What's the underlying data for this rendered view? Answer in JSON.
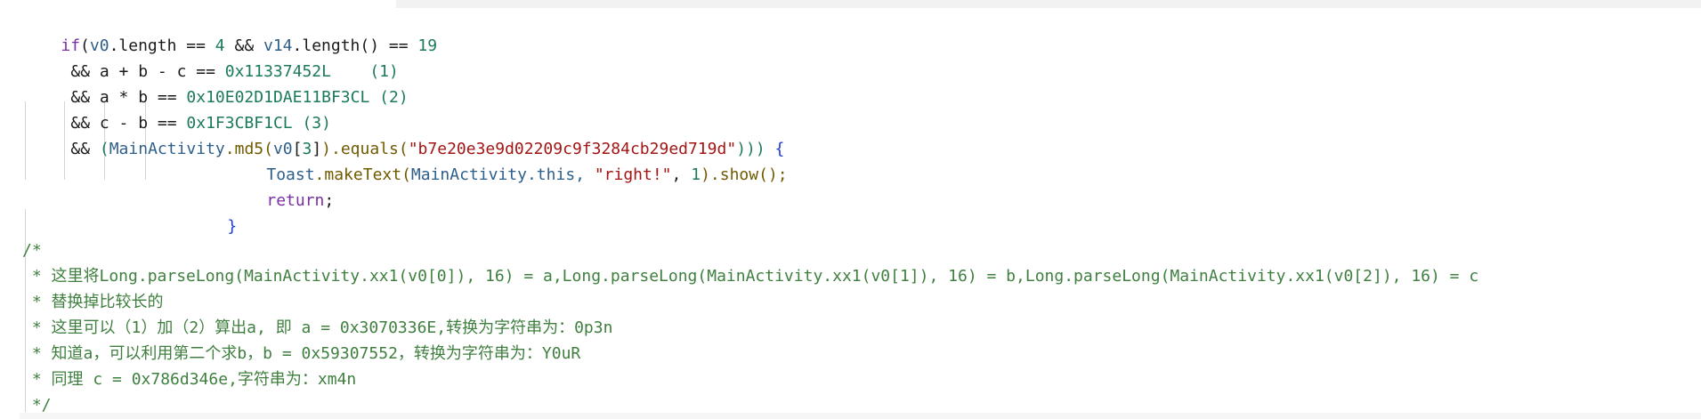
{
  "colors": {
    "keyword": "#7a2fa3",
    "keyword_blue": "#1a3ccf",
    "number": "#1b7a5a",
    "identifier": "#2e5f8a",
    "method": "#705a00",
    "plain": "#1a1a1a",
    "string": "#a31515",
    "brace": "#1a3ccf",
    "comment": "#3f7f3f"
  },
  "code": {
    "line1": {
      "t1": "if",
      "t2": "(",
      "t3": "v0",
      "t4": ".length == ",
      "t5": "4",
      "t6": " && ",
      "t7": "v14",
      "t8": ".length() == ",
      "t9": "19"
    },
    "line2": {
      "t1": "&& a + b - c == ",
      "t2": "0x11337452L",
      "t3": "    (1)"
    },
    "line3": {
      "t1": "&& a * b == ",
      "t2": "0x10E02D1DAE11BF3CL",
      "t3": " (2)"
    },
    "line4": {
      "t1": "&& c - b == ",
      "t2": "0x1F3CBF1CL",
      "t3": " (3)"
    },
    "line5": {
      "t1": "&& ",
      "t2": "(",
      "t3": "MainActivity",
      "t4": ".md5(",
      "t5": "v0",
      "t6": "[",
      "t7": "3",
      "t8": "]",
      "t9": ").equals(",
      "t10": "\"b7e20e3e9d02209c9f3284cb29ed719d\"",
      "t11": ")))",
      "t12": " {"
    },
    "line6": {
      "t1": "Toast",
      "t2": ".makeText(",
      "t3": "MainActivity",
      "t4": ".this, ",
      "t5": "\"right!\"",
      "t6": ", ",
      "t7": "1",
      "t8": ").show();"
    },
    "line7": {
      "t1": "return",
      "t2": ";"
    },
    "line8": {
      "t1": "}"
    }
  },
  "comment": {
    "open": "/*",
    "lines": [
      " * 这里将Long.parseLong(MainActivity.xx1(v0[0]), 16) = a,Long.parseLong(MainActivity.xx1(v0[1]), 16) = b,Long.parseLong(MainActivity.xx1(v0[2]), 16) = c",
      " * 替换掉比较长的",
      " * 这里可以（1）加（2）算出a, 即 a = 0x3070336E,转换为字符串为：0p3n",
      " * 知道a，可以利用第二个求b，b = 0x59307552，转换为字符串为：Y0uR",
      " * 同理 c = 0x786d346e,字符串为：xm4n"
    ],
    "close": " */"
  }
}
